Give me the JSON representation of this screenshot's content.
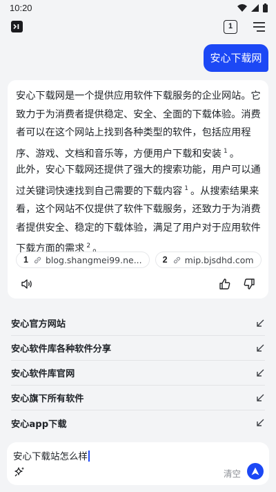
{
  "status_bar": {
    "time": "10:20"
  },
  "app_bar": {
    "logo_text": ">I",
    "tab_count": "1"
  },
  "user_message": "安心下载网",
  "answer": {
    "p1_text": "安心下载网是一个提供应用软件下载服务的企业网站。它致力于为消费者提供稳定、安全、全面的下载体验。消费者可以在这个网站上找到各种类型的软件，包括应用程序、游戏、文档和音乐等，方便用户下载和安装",
    "p1_ref": "1",
    "p1_end": "。",
    "p2_text": "此外，安心下载网还提供了强大的搜索功能，用户可以通过关键词快速找到自己需要的下载内容",
    "p2_ref1": "1",
    "p2_mid": "。从搜索结果来看，这个网站不仅提供了软件下载服务，还致力于为消费者提供安全、稳定的下载体验，满足了用户对于应用软件下载方面的需求",
    "p2_ref2": "2",
    "p2_end": "。",
    "sources": [
      {
        "num": "1",
        "domain": "blog.shangmei99.ne..."
      },
      {
        "num": "2",
        "domain": "mip.bjsdhd.com"
      }
    ]
  },
  "suggestions": [
    "安心官方网站",
    "安心软件库各种软件分享",
    "安心软件库官网",
    "安心旗下所有软件",
    "安心app下载"
  ],
  "input": {
    "value": "安心下载站怎么样",
    "clear_label": "清空"
  },
  "colors": {
    "accent": "#1c48f5",
    "background": "#f3f4f6"
  }
}
